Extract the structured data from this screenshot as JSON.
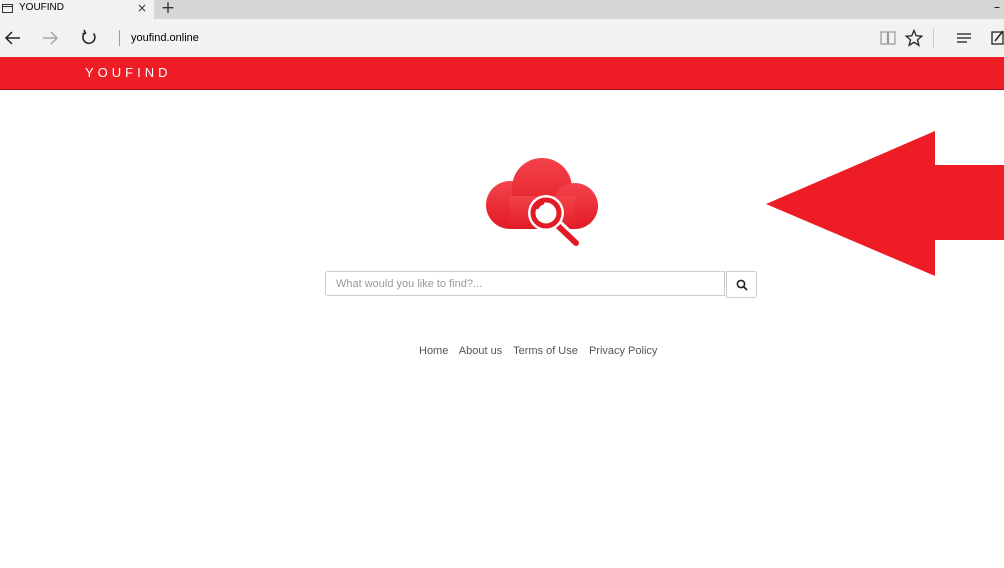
{
  "browser": {
    "tab_title": "YOUFIND",
    "tab_close": "×",
    "new_tab": "+",
    "minimize": "–",
    "url": "youfind.online"
  },
  "header": {
    "brand": "YOUFIND",
    "color": "#ee1c24"
  },
  "search": {
    "placeholder": "What would you like to find?..."
  },
  "footer": {
    "links": [
      "Home",
      "About us",
      "Terms of Use",
      "Privacy Policy"
    ]
  },
  "icons": {
    "back": "back-arrow-icon",
    "forward": "forward-arrow-icon",
    "refresh": "refresh-icon",
    "reading_view": "book-icon",
    "favorite": "star-icon",
    "hub": "hub-lines-icon",
    "note": "pen-note-icon",
    "search": "magnifier-icon",
    "logo": "cloud-magnifier-icon"
  },
  "annotation_color": "#ee1c24"
}
